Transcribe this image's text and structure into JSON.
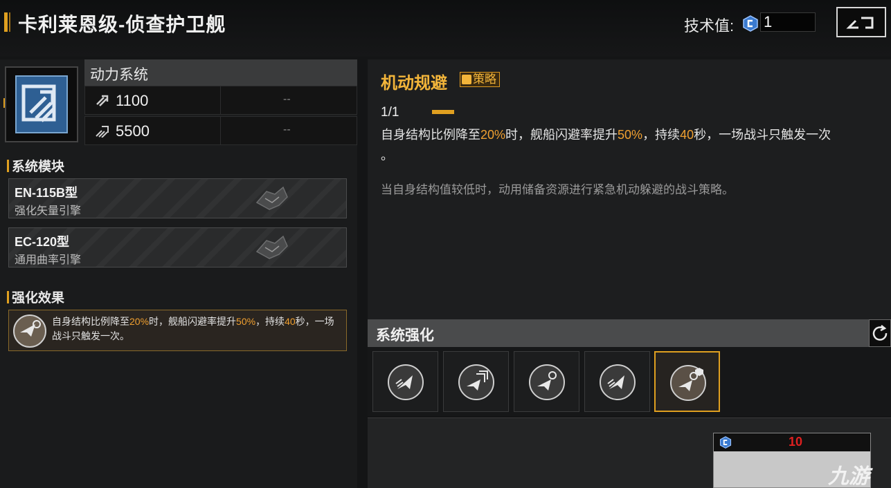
{
  "header": {
    "title": "卡利莱恩级-侦查护卫舰",
    "tech_label": "技术值:",
    "tech_value": "1",
    "back_icon": "back-arrow-icon"
  },
  "system": {
    "name": "动力系统",
    "icon": "engine-chevron-icon",
    "stats": [
      {
        "icon": "speed-icon",
        "value": "1100",
        "extra": "--"
      },
      {
        "icon": "warp-speed-icon",
        "value": "5500",
        "extra": "--"
      }
    ]
  },
  "modules_section": {
    "title": "系统模块",
    "items": [
      {
        "name": "EN-115B型",
        "sub": "强化矢量引擎"
      },
      {
        "name": "EC-120型",
        "sub": "通用曲率引擎"
      }
    ]
  },
  "effects_section": {
    "title": "强化效果",
    "text_a": "自身结构比例降至",
    "pct_a": "20%",
    "text_b": "时，舰船闪避率提升",
    "pct_b": "50%",
    "text_c": "，持续",
    "dur": "40",
    "text_d": "秒，一场战斗只触发一次。"
  },
  "skill": {
    "title": "机动规避",
    "badge": "策略",
    "level": "1/1",
    "desc_a": "自身结构比例降至",
    "pct_a": "20%",
    "desc_b": "时，舰船闪避率提升",
    "pct_b": "50%",
    "desc_c": "，持续",
    "dur": "40",
    "desc_d": "秒，一场战斗只触发一次",
    "desc_e": "。",
    "flavor": "当自身结构值较低时，动用储备资源进行紧急机动躲避的战斗策略。"
  },
  "enhance": {
    "title": "系统强化",
    "refresh_icon": "refresh-icon",
    "slots": [
      {
        "icon": "thrust-jet-icon",
        "selected": false
      },
      {
        "icon": "boost-jet-icon",
        "selected": false
      },
      {
        "icon": "evade-jet-icon",
        "selected": false
      },
      {
        "icon": "thrust-jet-icon",
        "selected": false
      },
      {
        "icon": "evade-strategy-icon",
        "selected": true
      }
    ]
  },
  "cost": {
    "icon": "tech-point-icon",
    "value": "10"
  },
  "watermark": "九游",
  "colors": {
    "accent": "#e0a020",
    "highlight": "#f0a030",
    "cost": "#e02020"
  }
}
